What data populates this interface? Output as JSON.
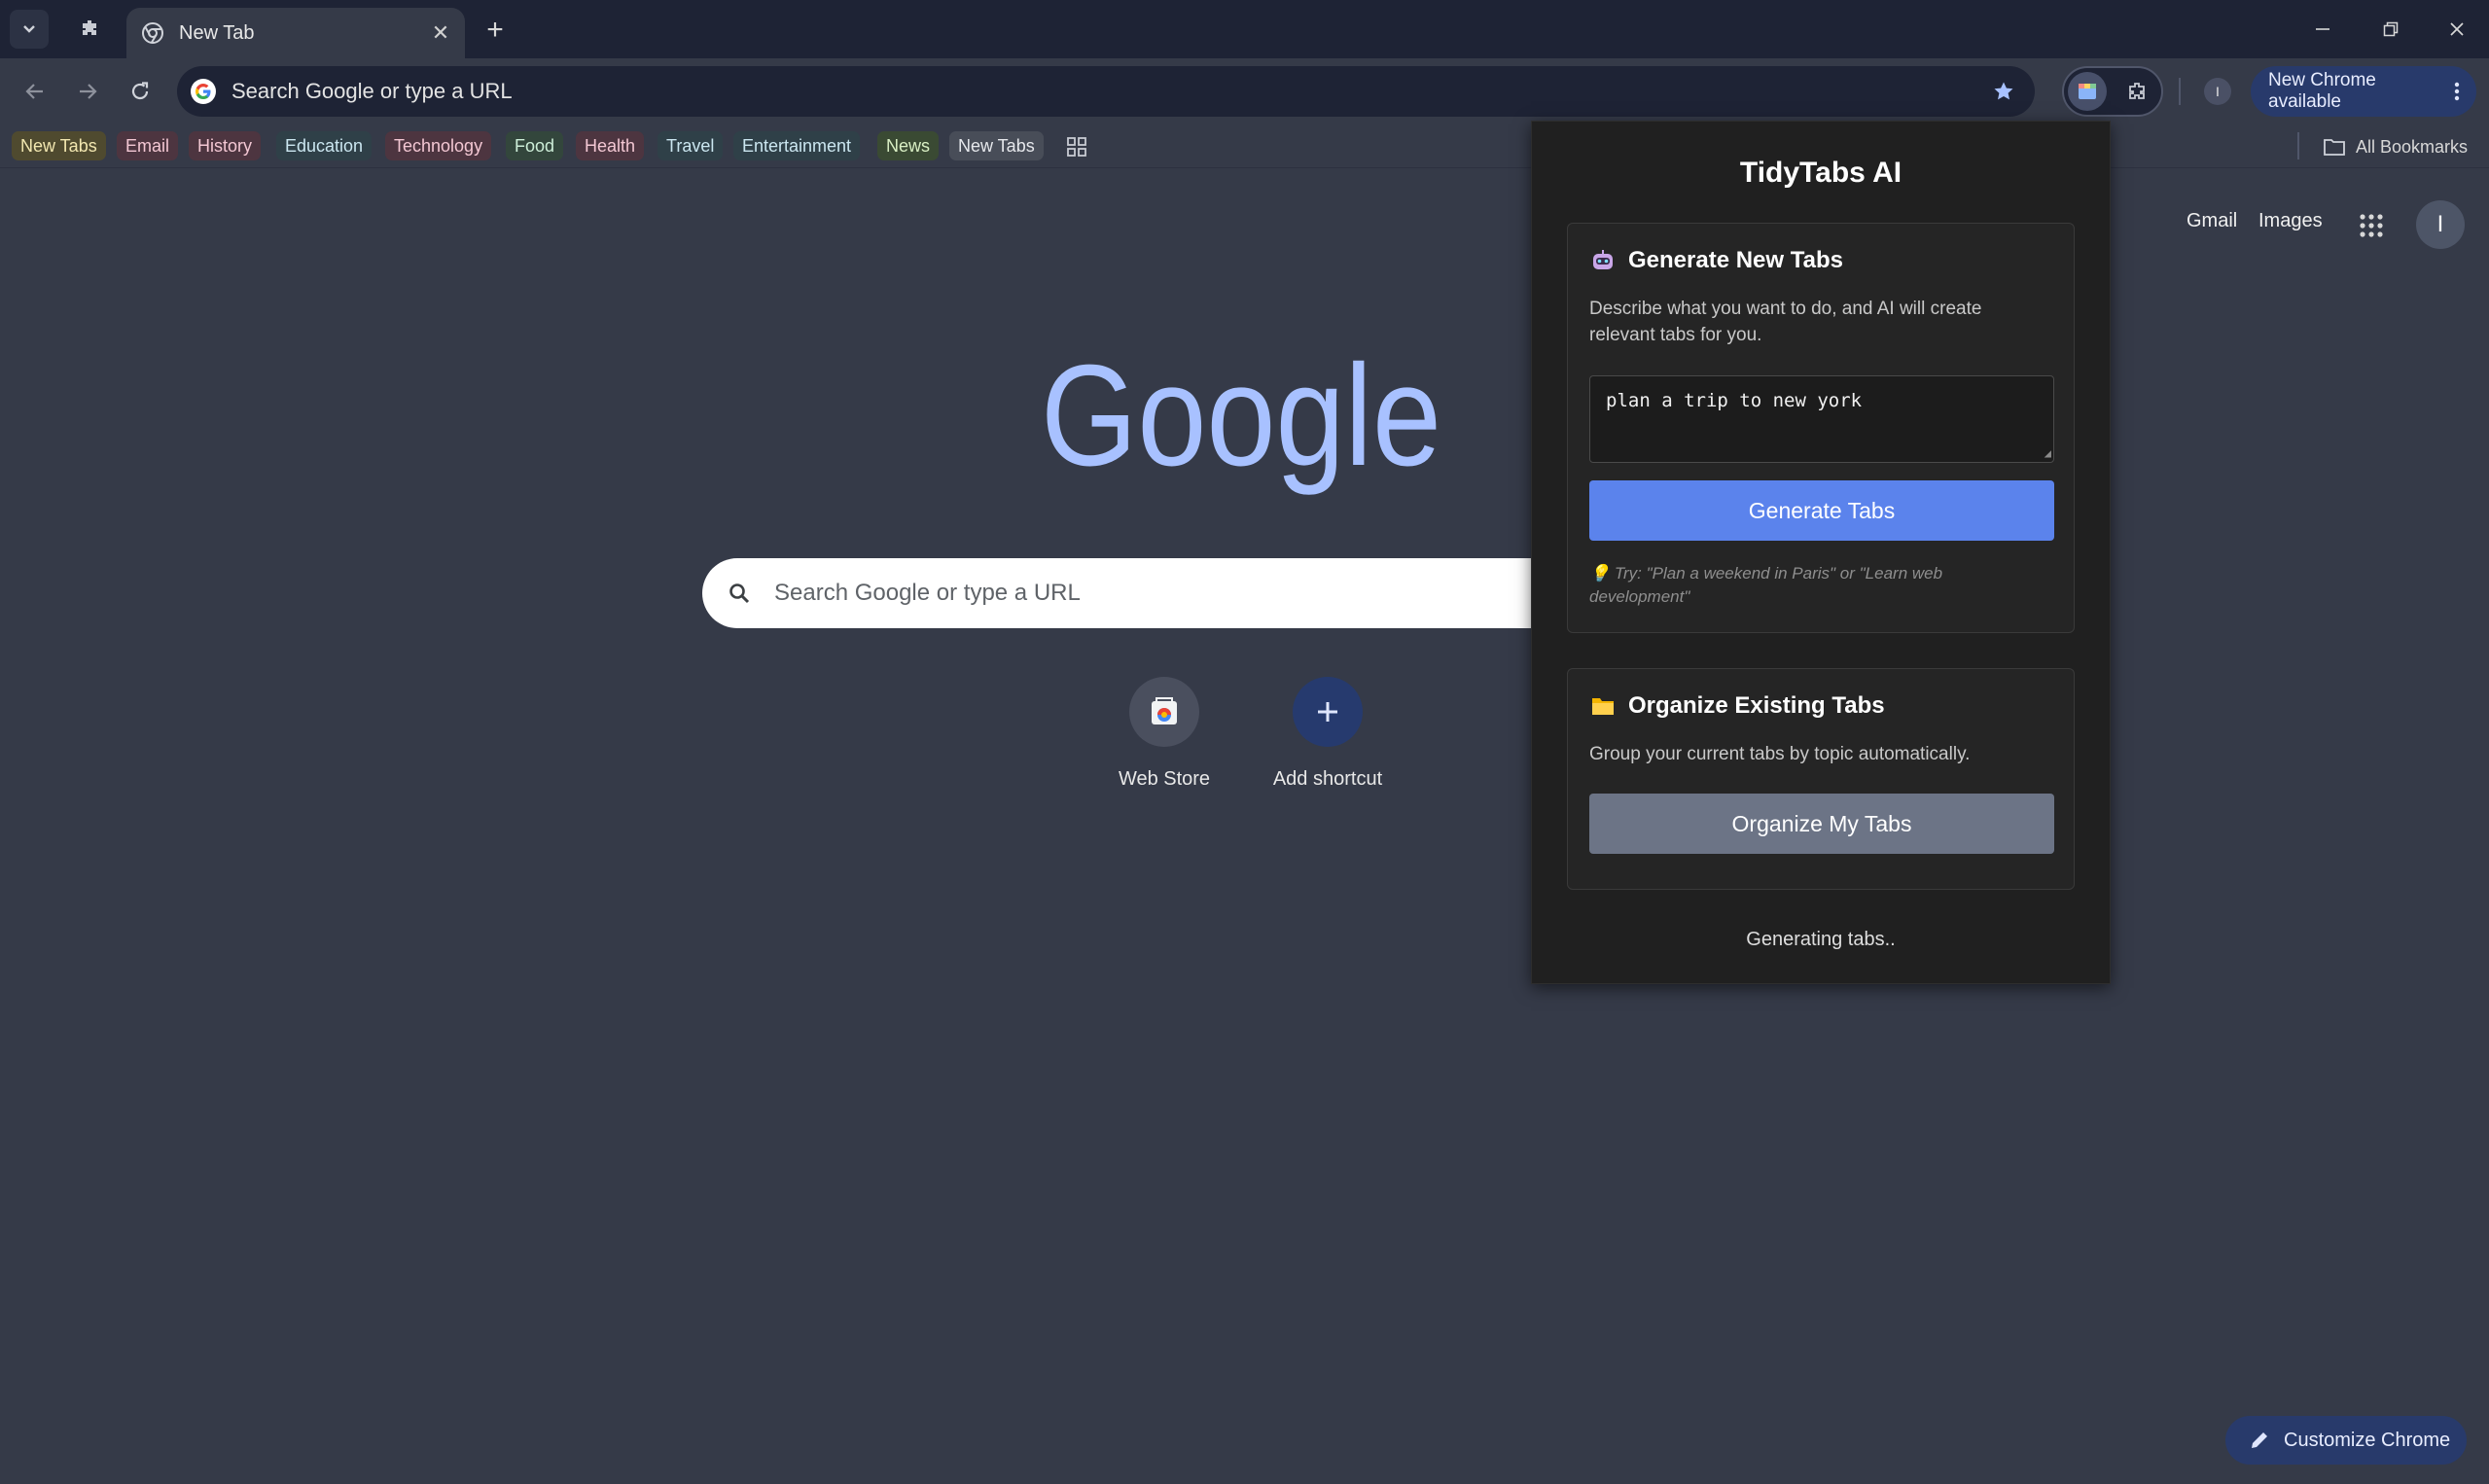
{
  "browser": {
    "tab": {
      "title": "New Tab"
    },
    "omnibox": {
      "placeholder": "Search Google or type a URL"
    },
    "profile_initial": "I",
    "update_label": "New Chrome available",
    "bookmarks": [
      {
        "label": "New Tabs",
        "bg": "#4f4a2f",
        "fg": "#f2e7b0"
      },
      {
        "label": "Email",
        "bg": "#4d3540",
        "fg": "#f3c7d3"
      },
      {
        "label": "History",
        "bg": "#4d3540",
        "fg": "#f3c7d3"
      },
      {
        "label": "Education",
        "bg": "#2f4048",
        "fg": "#cbe6f0"
      },
      {
        "label": "Technology",
        "bg": "#4d3540",
        "fg": "#f3c7d3"
      },
      {
        "label": "Food",
        "bg": "#33463c",
        "fg": "#cdeed8"
      },
      {
        "label": "Health",
        "bg": "#4d3540",
        "fg": "#f3c7d3"
      },
      {
        "label": "Travel",
        "bg": "#2f4048",
        "fg": "#cbe6f0"
      },
      {
        "label": "Entertainment",
        "bg": "#2f4048",
        "fg": "#cbe6f0"
      },
      {
        "label": "News",
        "bg": "#3a4a33",
        "fg": "#d9efc4"
      },
      {
        "label": "New Tabs",
        "bg": "#484d58",
        "fg": "#e6e8ec"
      }
    ],
    "all_bookmarks_label": "All Bookmarks"
  },
  "ntp": {
    "gmail_label": "Gmail",
    "images_label": "Images",
    "avatar_initial": "I",
    "search_placeholder": "Search Google or type a URL",
    "shortcuts": [
      {
        "label": "Web Store"
      },
      {
        "label": "Add shortcut"
      }
    ],
    "customize_label": "Customize Chrome"
  },
  "popup": {
    "title": "TidyTabs AI",
    "generate": {
      "heading": "Generate New Tabs",
      "description": "Describe what you want to do, and AI will create relevant tabs for you.",
      "prompt_value": "plan a trip to new york",
      "button_label": "Generate Tabs",
      "hint": "💡 Try: \"Plan a weekend in Paris\" or \"Learn web development\""
    },
    "organize": {
      "heading": "Organize Existing Tabs",
      "description": "Group your current tabs by topic automatically.",
      "button_label": "Organize My Tabs"
    },
    "status": "Generating tabs.."
  }
}
